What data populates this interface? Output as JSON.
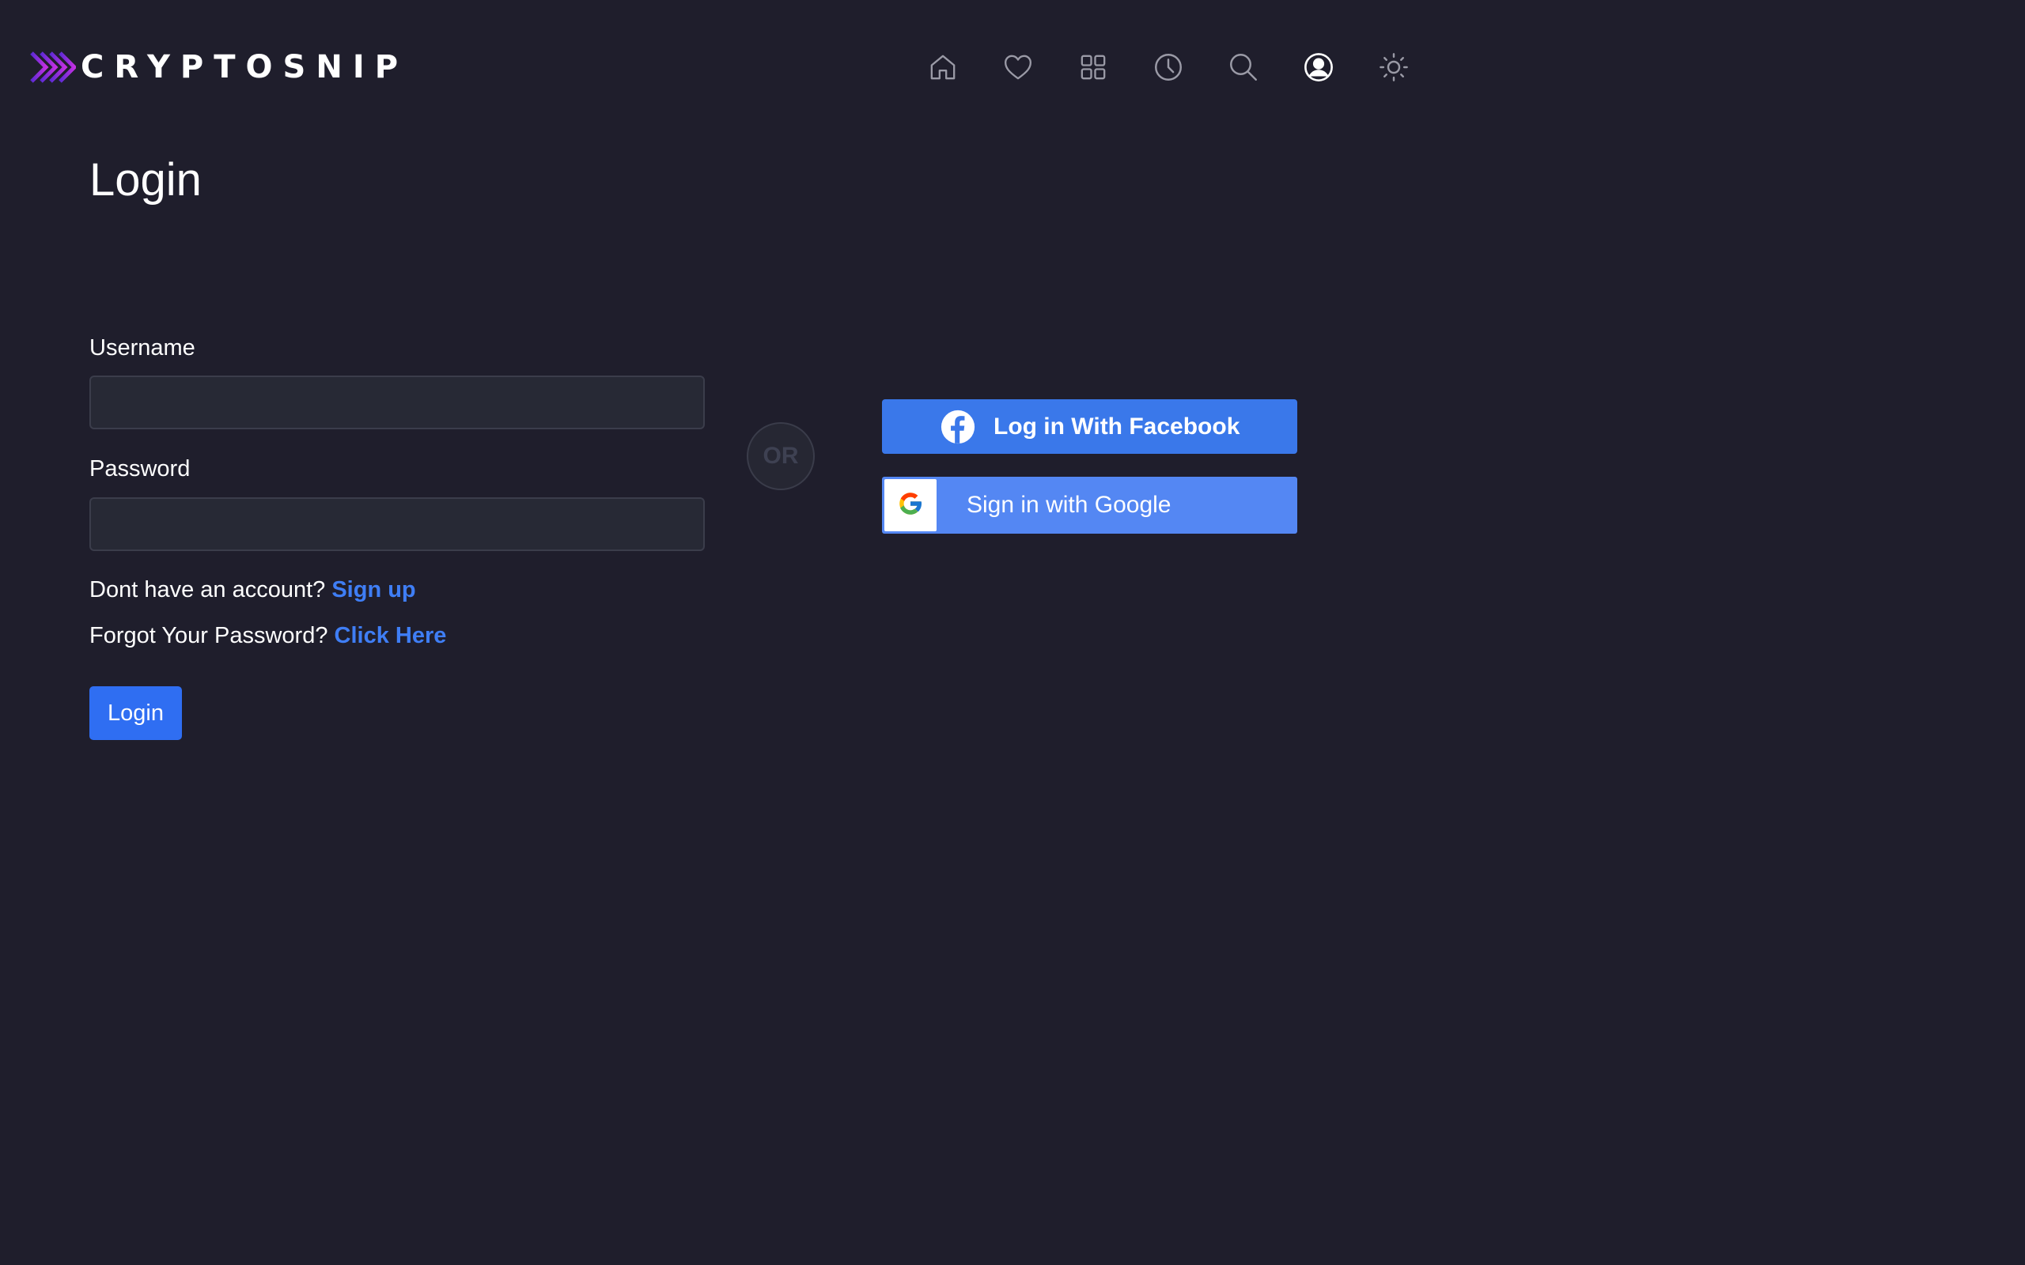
{
  "header": {
    "brand": "CRYPTOSNIP",
    "nav": [
      {
        "icon": "home-icon"
      },
      {
        "icon": "heart-icon"
      },
      {
        "icon": "grid-icon"
      },
      {
        "icon": "history-clock-icon"
      },
      {
        "icon": "search-icon"
      },
      {
        "icon": "user-account-icon"
      },
      {
        "icon": "sun-theme-icon"
      }
    ]
  },
  "page": {
    "title": "Login"
  },
  "form": {
    "username_label": "Username",
    "username_value": "",
    "password_label": "Password",
    "password_value": "",
    "no_account_text": "Dont have an account? ",
    "signup_link": "Sign up",
    "forgot_text": "Forgot Your Password? ",
    "forgot_link": "Click Here",
    "submit_label": "Login"
  },
  "divider": {
    "label": "OR"
  },
  "social": {
    "facebook_label": "Log in With Facebook",
    "google_label": "Sign in with Google"
  },
  "colors": {
    "background": "#1f1e2c",
    "accent": "#2f6ef2",
    "link": "#3f7ef5",
    "facebook": "#3a78ea",
    "google": "#5487f3",
    "logo_gradient_start": "#6a2bd9",
    "logo_gradient_end": "#c02ee0"
  }
}
